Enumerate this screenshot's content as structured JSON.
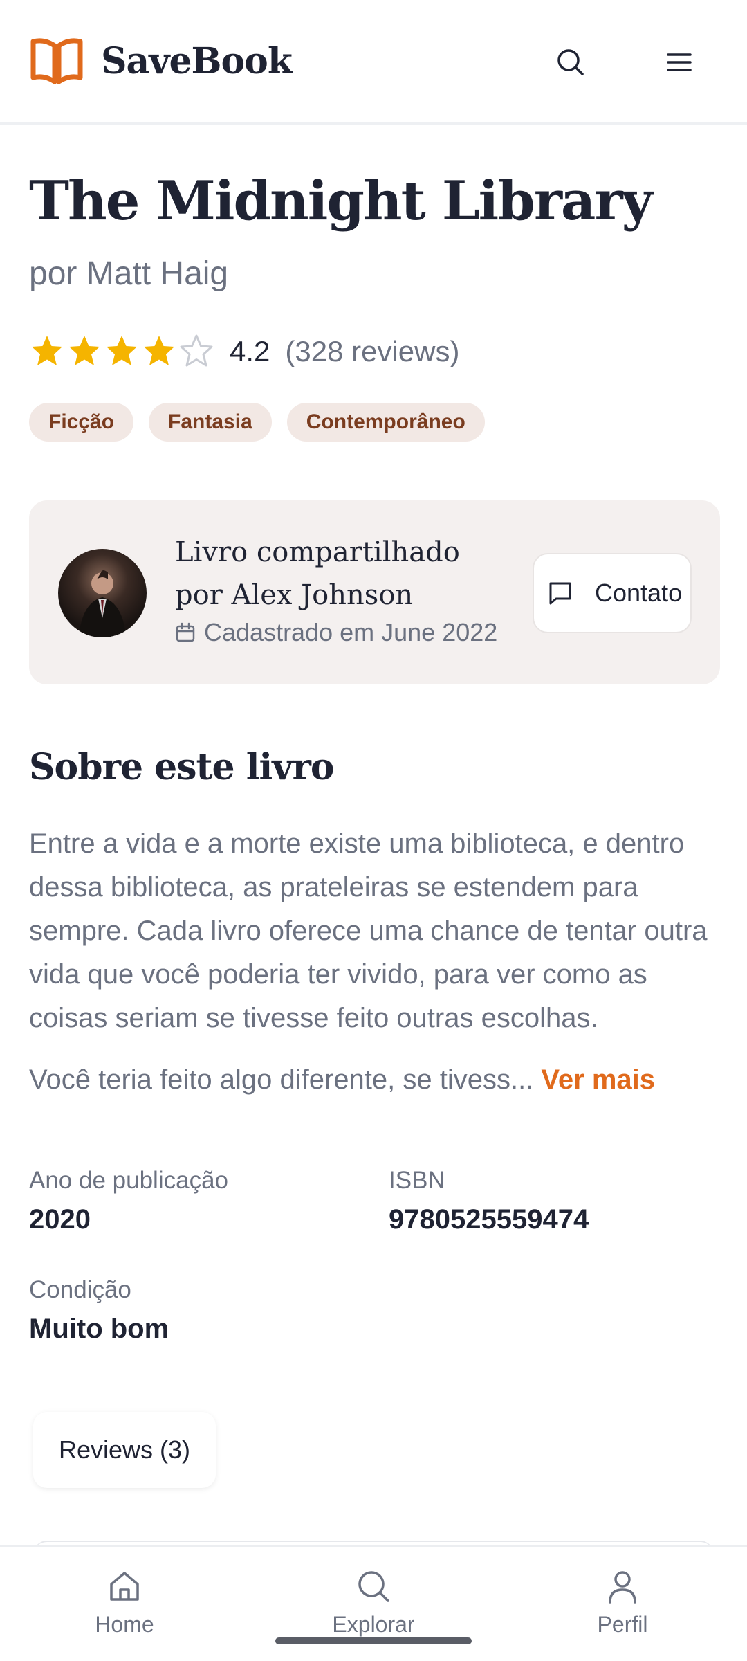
{
  "header": {
    "app_name": "SaveBook",
    "brand_color": "#e06a1c",
    "icons": [
      "book-open-icon",
      "search-icon",
      "menu-icon"
    ]
  },
  "book": {
    "title": "The Midnight Library",
    "author_line": "por Matt Haig",
    "rating_value": "4.2",
    "rating_count": "(328 reviews)",
    "stars_filled": 4,
    "stars_total": 5,
    "tags": [
      "Ficção",
      "Fantasia",
      "Contemporâneo"
    ]
  },
  "owner": {
    "shared_by": "Livro compartilhado por Alex Johnson",
    "registered": "Cadastrado em June 2022",
    "contact_label": "Contato"
  },
  "about": {
    "heading": "Sobre este livro",
    "paragraph1": "Entre a vida e a morte existe uma biblioteca, e dentro dessa biblioteca, as prateleiras se estendem para sempre. Cada livro oferece uma chance de tentar outra vida que você poderia ter vivido, para ver como as coisas seriam se tivesse feito outras escolhas.",
    "paragraph2": "Você teria feito algo diferente, se tivess...",
    "more_label": "Ver mais"
  },
  "details": {
    "year_label": "Ano de publicação",
    "year_value": "2020",
    "isbn_label": "ISBN",
    "isbn_value": "9780525559474",
    "condition_label": "Condição",
    "condition_value": "Muito bom"
  },
  "reviews": {
    "tab_label": "Reviews (3)"
  },
  "bottom_nav": {
    "items": [
      {
        "label": "Home",
        "icon": "home-icon"
      },
      {
        "label": "Explorar",
        "icon": "search-icon"
      },
      {
        "label": "Perfil",
        "icon": "user-icon"
      }
    ]
  }
}
